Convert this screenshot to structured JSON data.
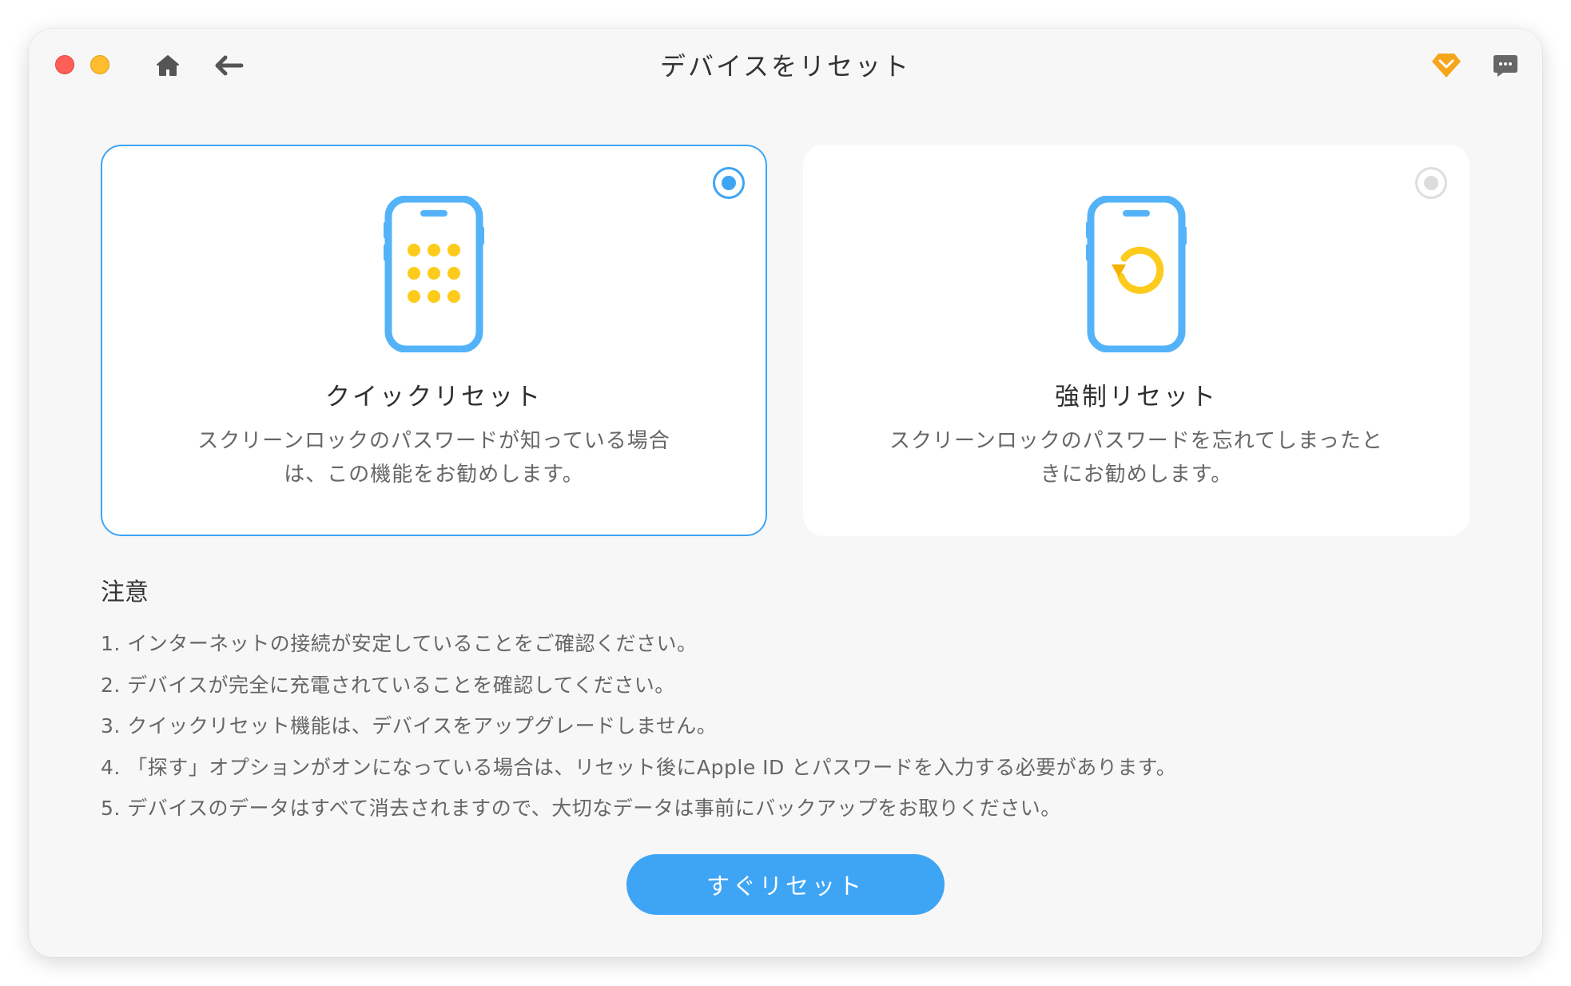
{
  "window": {
    "title": "デバイスをリセット"
  },
  "toolbar": {
    "home_icon": "home-icon",
    "back_icon": "back-arrow-icon",
    "premium_icon": "diamond-icon",
    "feedback_icon": "chat-bubble-icon"
  },
  "options": [
    {
      "title": "クイックリセット",
      "description_line1": "スクリーンロックのパスワードが知っている場合",
      "description_line2": "は、この機能をお勧めします。",
      "selected": true,
      "icon": "phone-keypad-icon"
    },
    {
      "title": "強制リセット",
      "description_line1": "スクリーンロックのパスワードを忘れてしまったと",
      "description_line2": "きにお勧めします。",
      "selected": false,
      "icon": "phone-reset-icon"
    }
  ],
  "notes": {
    "title": "注意",
    "items": [
      "1. インターネットの接続が安定していることをご確認ください。",
      "2. デバイスが完全に充電されていることを確認してください。",
      "3. クイックリセット機能は、デバイスをアップグレードしません。",
      "4. 「探す」オプションがオンになっている場合は、リセット後にApple ID とパスワードを入力する必要があります。",
      "5. デバイスのデータはすべて消去されますので、大切なデータは事前にバックアップをお取りください。"
    ]
  },
  "action": {
    "reset_label": "すぐリセット"
  },
  "colors": {
    "accent": "#3ea5f5",
    "icon_yellow": "#fdcb1c",
    "premium_orange": "#f7a51b",
    "close_red": "#fe5f57",
    "minimize_yellow": "#febc2e"
  }
}
